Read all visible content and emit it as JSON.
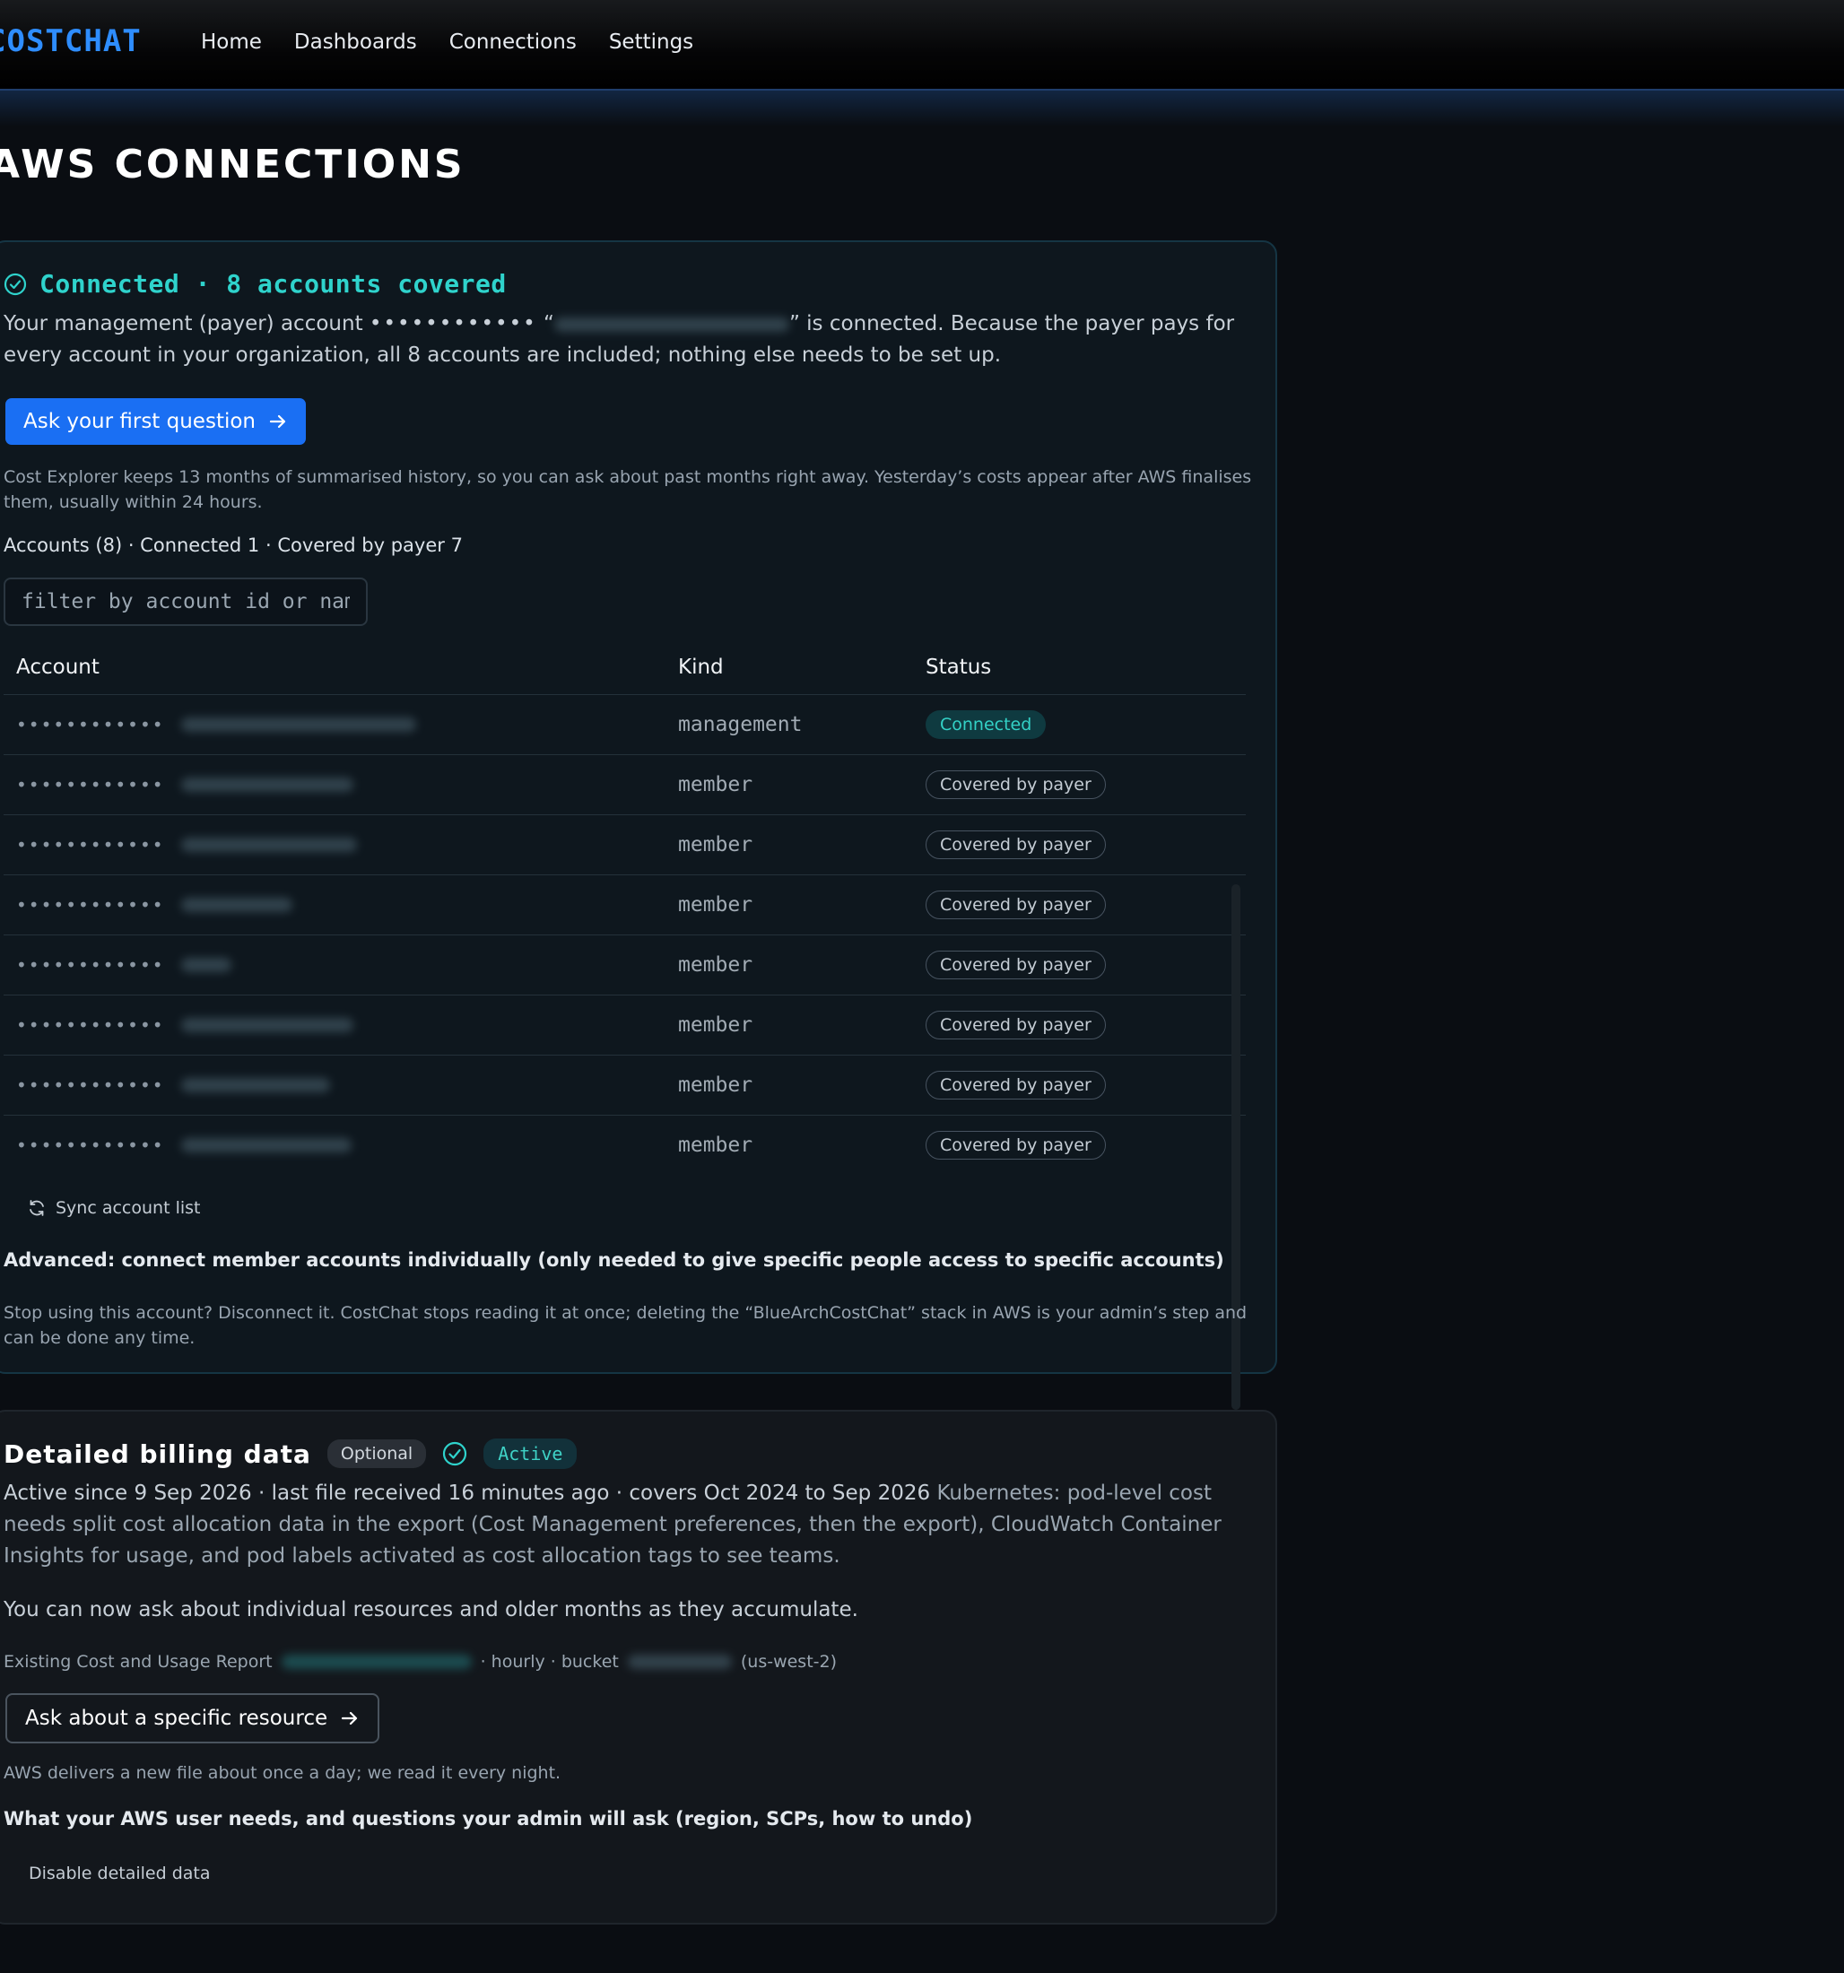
{
  "nav": {
    "logo": "COSTCHAT",
    "links": [
      "Home",
      "Dashboards",
      "Connections",
      "Settings"
    ]
  },
  "page_title": "AWS CONNECTIONS",
  "connected": {
    "title": "Connected · 8 accounts covered",
    "para_a": "Your management (payer) account ",
    "masked": "••••••••••••",
    "quote_open": " “",
    "para_b": "” is connected. Because the payer pays for every account in your organization, all 8 accounts are included; nothing else needs to be set up.",
    "cta": "Ask your first question",
    "history_note": "Cost Explorer keeps 13 months of summarised history, so you can ask about past months right away. Yesterday’s costs appear after AWS finalises them, usually within 24 hours.",
    "accounts_summary": "Accounts (8) · Connected 1 · Covered by payer 7",
    "filter_placeholder": "filter by account id or name",
    "table": {
      "headers": [
        "Account",
        "Kind",
        "Status"
      ],
      "rows": [
        {
          "id": "••••••••••••",
          "kind": "management",
          "status": "Connected"
        },
        {
          "id": "••••••••••••",
          "kind": "member",
          "status": "Covered by payer"
        },
        {
          "id": "••••••••••••",
          "kind": "member",
          "status": "Covered by payer"
        },
        {
          "id": "••••••••••••",
          "kind": "member",
          "status": "Covered by payer"
        },
        {
          "id": "••••••••••••",
          "kind": "member",
          "status": "Covered by payer"
        },
        {
          "id": "••••••••••••",
          "kind": "member",
          "status": "Covered by payer"
        },
        {
          "id": "••••••••••••",
          "kind": "member",
          "status": "Covered by payer"
        },
        {
          "id": "••••••••••••",
          "kind": "member",
          "status": "Covered by payer"
        }
      ]
    },
    "sync": "Sync account list",
    "advanced": "Advanced: connect member accounts individually (only needed to give specific people access to specific accounts)",
    "disconnect_note": "Stop using this account? Disconnect it. CostChat stops reading it at once; deleting the “BlueArchCostChat” stack in AWS is your admin’s step and can be done any time."
  },
  "billing": {
    "title": "Detailed billing data",
    "optional": "Optional",
    "active": "Active",
    "status_line": "Active since 9 Sep 2026 · last file received 16 minutes ago · covers Oct 2024 to Sep 2026 ",
    "k8s_note": "Kubernetes: pod-level cost needs split cost allocation data in the export (Cost Management preferences, then the export), CloudWatch Container Insights for usage, and pod labels activated as cost allocation tags to see teams.",
    "ask_now": "You can now ask about individual resources and older months as they accumulate.",
    "meta_a": "Existing Cost and Usage Report",
    "meta_b": "· hourly · bucket",
    "meta_c": "(us-west-2)",
    "cta": "Ask about a specific resource",
    "delivery_note": "AWS delivers a new file about once a day; we read it every night.",
    "advanced": "What your AWS user needs, and questions your admin will ask (region, SCPs, how to undo)",
    "disable": "Disable detailed data"
  },
  "colors": {
    "accent_blue": "#1a6ff3",
    "teal": "#2fd3cc",
    "background": "#0a0d12"
  }
}
